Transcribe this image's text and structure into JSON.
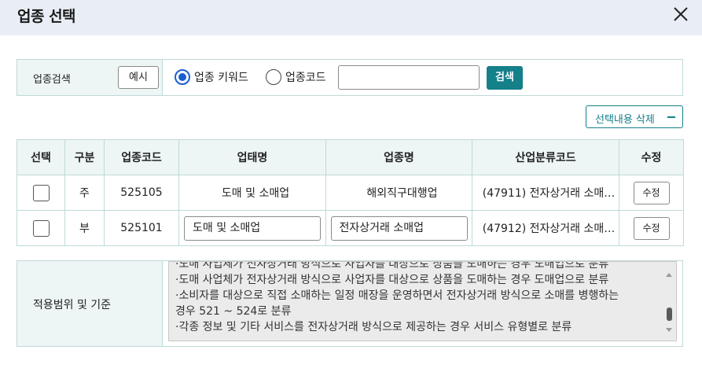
{
  "header": {
    "title": "업종 선택"
  },
  "search": {
    "label": "업종검색",
    "example_button": "예시",
    "radio_keyword": "업종 키워드",
    "radio_code": "업종코드",
    "input_value": "",
    "search_button": "검색"
  },
  "delete_button": "선택내용 삭제",
  "table": {
    "headers": [
      "선택",
      "구분",
      "업종코드",
      "업태명",
      "업종명",
      "산업분류코드",
      "수정"
    ],
    "rows": [
      {
        "type": "주",
        "code": "525105",
        "business_type": "도매 및 소매업",
        "business_name": "해외직구대행업",
        "industry_code": "(47911) 전자상거래 소매…",
        "edit": "수정"
      },
      {
        "type": "부",
        "code": "525101",
        "business_type": "도매 및 소매업",
        "business_name": "전자상거래 소매업",
        "industry_code": "(47912) 전자상거래 소매…",
        "edit": "수정"
      }
    ]
  },
  "scope": {
    "label": "적용범위 및 기준",
    "lines": [
      "·도매 사업체가 전자상거래 방식으로 사업자를 대상으로 상품을 도매하는 경우 도매업으로 분류",
      "·도매 사업체가 전자상거래 방식으로 사업자를 대상으로 상품을 도매하는 경우 도매업으로 분류",
      "·소비자를 대상으로 직접 소매하는 일정 매장을 운영하면서 전자상거래 방식으로 소매를 병행하는",
      "경우 521 ~ 524로 분류",
      "·각종 정보 및 기타 서비스를 전자상거래 방식으로 제공하는 경우 서비스 유형별로 분류"
    ]
  },
  "colors": {
    "accent": "#13808a",
    "header_bg": "#e9eef6",
    "main_type": "#e02020",
    "radio_checked": "#1a5fd0"
  }
}
